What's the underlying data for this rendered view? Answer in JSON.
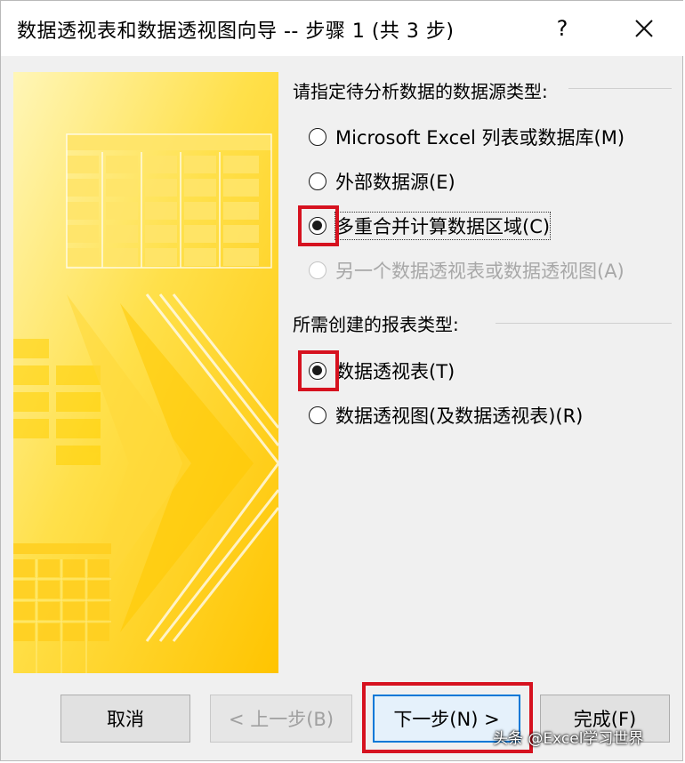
{
  "window": {
    "title": "数据透视表和数据透视图向导 -- 步骤 1 (共 3 步)",
    "help_label": "?"
  },
  "source_section": {
    "label": "请指定待分析数据的数据源类型:",
    "options": [
      {
        "label": "Microsoft Excel 列表或数据库(M)",
        "checked": false,
        "disabled": false
      },
      {
        "label": "外部数据源(E)",
        "checked": false,
        "disabled": false
      },
      {
        "label": "多重合并计算数据区域(C)",
        "checked": true,
        "disabled": false
      },
      {
        "label": "另一个数据透视表或数据透视图(A)",
        "checked": false,
        "disabled": true
      }
    ]
  },
  "report_section": {
    "label": "所需创建的报表类型:",
    "options": [
      {
        "label": "数据透视表(T)",
        "checked": true,
        "disabled": false
      },
      {
        "label": "数据透视图(及数据透视表)(R)",
        "checked": false,
        "disabled": false
      }
    ]
  },
  "buttons": {
    "cancel": "取消",
    "back": "< 上一步(B)",
    "next": "下一步(N) >",
    "finish": "完成(F)"
  },
  "watermark": "头条 @Excel学习世界",
  "colors": {
    "highlight": "#d6121f",
    "art_yellow": "#ffd21a",
    "dialog_bg": "#f0f0f0"
  }
}
